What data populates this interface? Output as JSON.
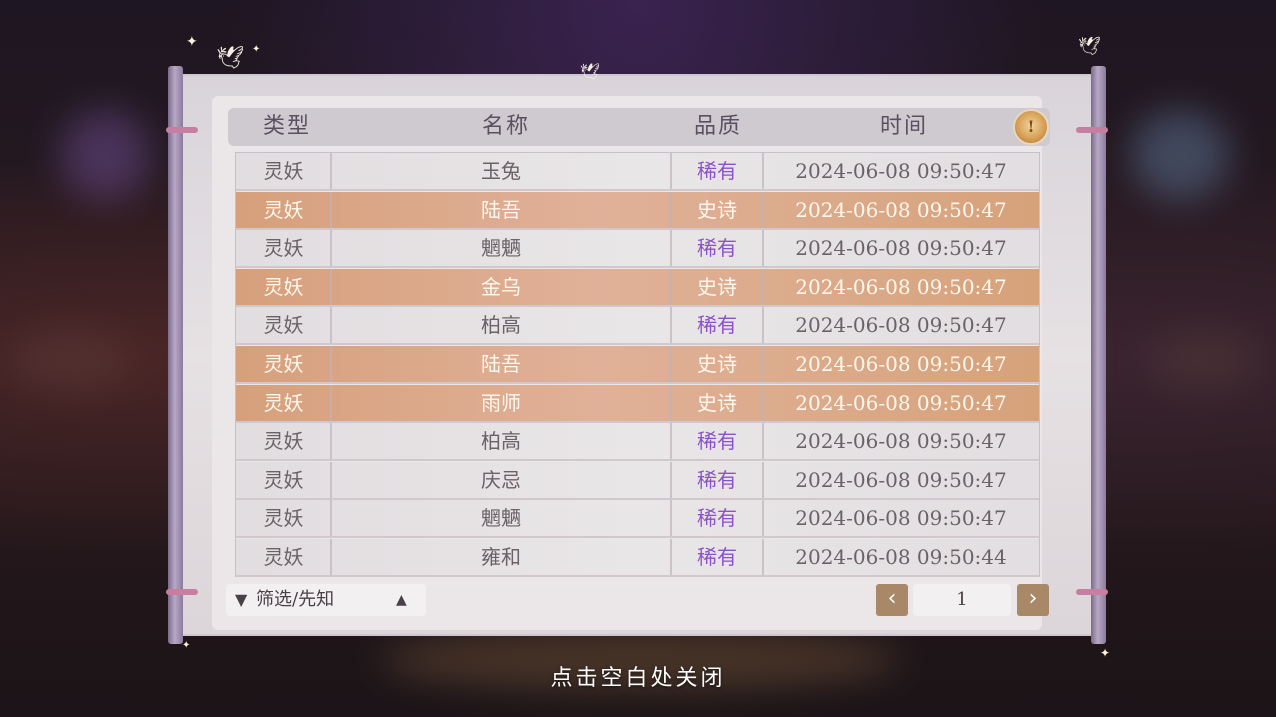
{
  "header": {
    "col_type": "类型",
    "col_name": "名称",
    "col_quality": "品质",
    "col_time": "时间",
    "info_icon": "info-icon"
  },
  "rows": [
    {
      "type": "灵妖",
      "name": "玉兔",
      "quality": "稀有",
      "time": "2024-06-08  09:50:47",
      "tier": "rare"
    },
    {
      "type": "灵妖",
      "name": "陆吾",
      "quality": "史诗",
      "time": "2024-06-08  09:50:47",
      "tier": "epic"
    },
    {
      "type": "灵妖",
      "name": "魍魉",
      "quality": "稀有",
      "time": "2024-06-08  09:50:47",
      "tier": "rare"
    },
    {
      "type": "灵妖",
      "name": "金乌",
      "quality": "史诗",
      "time": "2024-06-08  09:50:47",
      "tier": "epic"
    },
    {
      "type": "灵妖",
      "name": "柏高",
      "quality": "稀有",
      "time": "2024-06-08  09:50:47",
      "tier": "rare"
    },
    {
      "type": "灵妖",
      "name": "陆吾",
      "quality": "史诗",
      "time": "2024-06-08  09:50:47",
      "tier": "epic"
    },
    {
      "type": "灵妖",
      "name": "雨师",
      "quality": "史诗",
      "time": "2024-06-08  09:50:47",
      "tier": "epic"
    },
    {
      "type": "灵妖",
      "name": "柏高",
      "quality": "稀有",
      "time": "2024-06-08  09:50:47",
      "tier": "rare"
    },
    {
      "type": "灵妖",
      "name": "庆忌",
      "quality": "稀有",
      "time": "2024-06-08  09:50:47",
      "tier": "rare"
    },
    {
      "type": "灵妖",
      "name": "魍魉",
      "quality": "稀有",
      "time": "2024-06-08  09:50:47",
      "tier": "rare"
    },
    {
      "type": "灵妖",
      "name": "雍和",
      "quality": "稀有",
      "time": "2024-06-08  09:50:44",
      "tier": "rare"
    }
  ],
  "filter": {
    "label": "筛选/先知",
    "icon": "funnel-icon",
    "arrow_icon": "triangle-up-icon"
  },
  "pagination": {
    "current_page": "1",
    "prev_icon": "chevron-left-icon",
    "next_icon": "chevron-right-icon"
  },
  "close_hint": "点击空白处关闭",
  "colors": {
    "rare_text": "#8a52c8",
    "epic_row": "#d9a888",
    "page_button": "#a98868"
  }
}
